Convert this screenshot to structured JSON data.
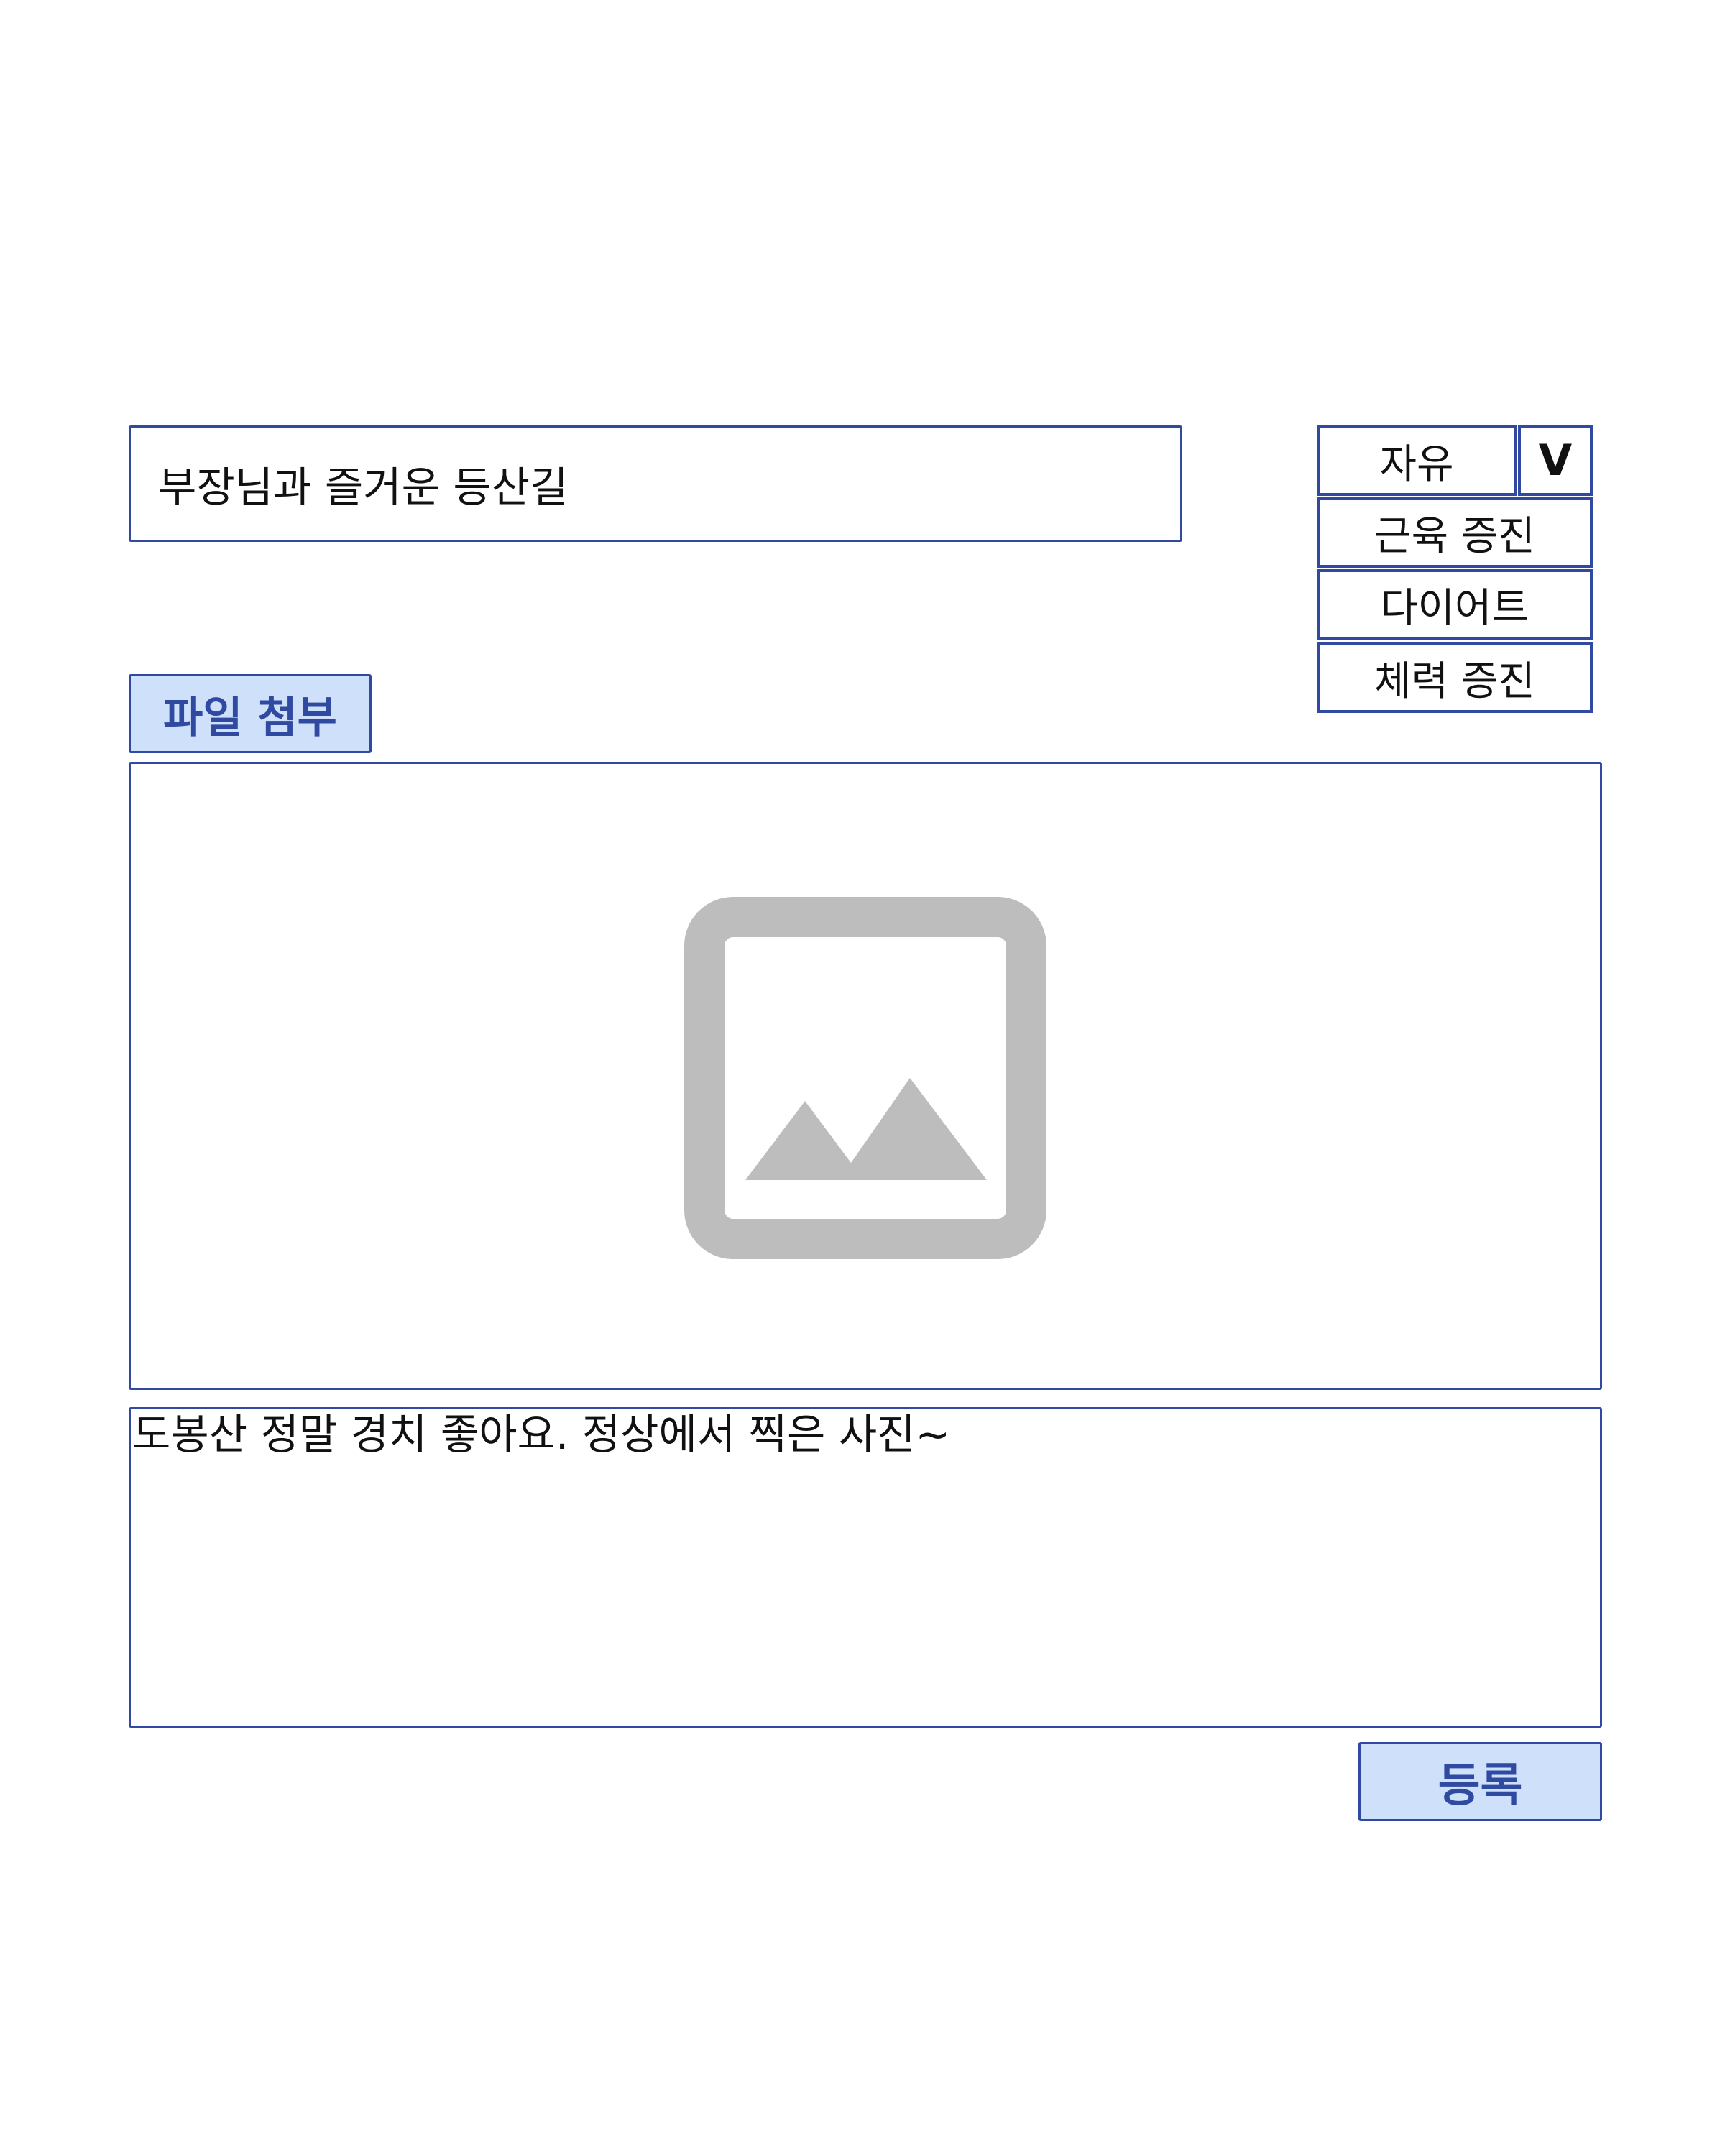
{
  "post_form": {
    "title_value": "부장님과 즐거운 등산길",
    "category": {
      "selected": "자유",
      "toggle_label": "V",
      "options": [
        "근육 증진",
        "다이어트",
        "체력 증진"
      ]
    },
    "attach_label": "파일 첨부",
    "image_placeholder_icon": "image-icon",
    "content_value": "도봉산 정말 경치 좋아요. 정상에서 찍은 사진~",
    "submit_label": "등록"
  },
  "colors": {
    "accent": "#2f4aa0",
    "button_bg": "#cfe0fb",
    "placeholder_gray": "#bdbdbd"
  }
}
